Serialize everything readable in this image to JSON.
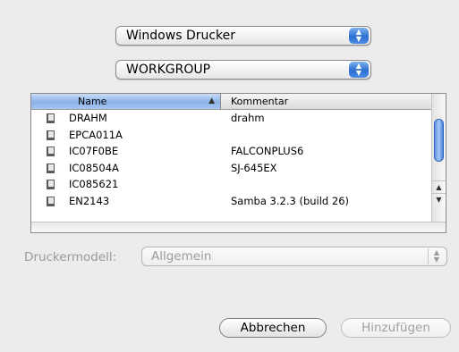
{
  "popups": {
    "printer_type": "Windows Drucker",
    "workgroup": "WORKGROUP"
  },
  "list": {
    "columns": {
      "name": "Name",
      "comment": "Kommentar"
    },
    "rows": [
      {
        "name": "DRAHM",
        "comment": "drahm"
      },
      {
        "name": "EPCA011A",
        "comment": ""
      },
      {
        "name": "IC07F0BE",
        "comment": "FALCONPLUS6"
      },
      {
        "name": "IC08504A",
        "comment": "SJ-645EX"
      },
      {
        "name": "IC085621",
        "comment": ""
      },
      {
        "name": "EN2143",
        "comment": "Samba 3.2.3 (build 26)"
      }
    ],
    "sort_indicator": "▲"
  },
  "model": {
    "label": "Druckermodell:",
    "value": "Allgemein"
  },
  "buttons": {
    "cancel": "Abbrechen",
    "add": "Hinzufügen"
  },
  "colors": {
    "accent": "#2d6fd1",
    "disabled_text": "#9a9a9a"
  }
}
